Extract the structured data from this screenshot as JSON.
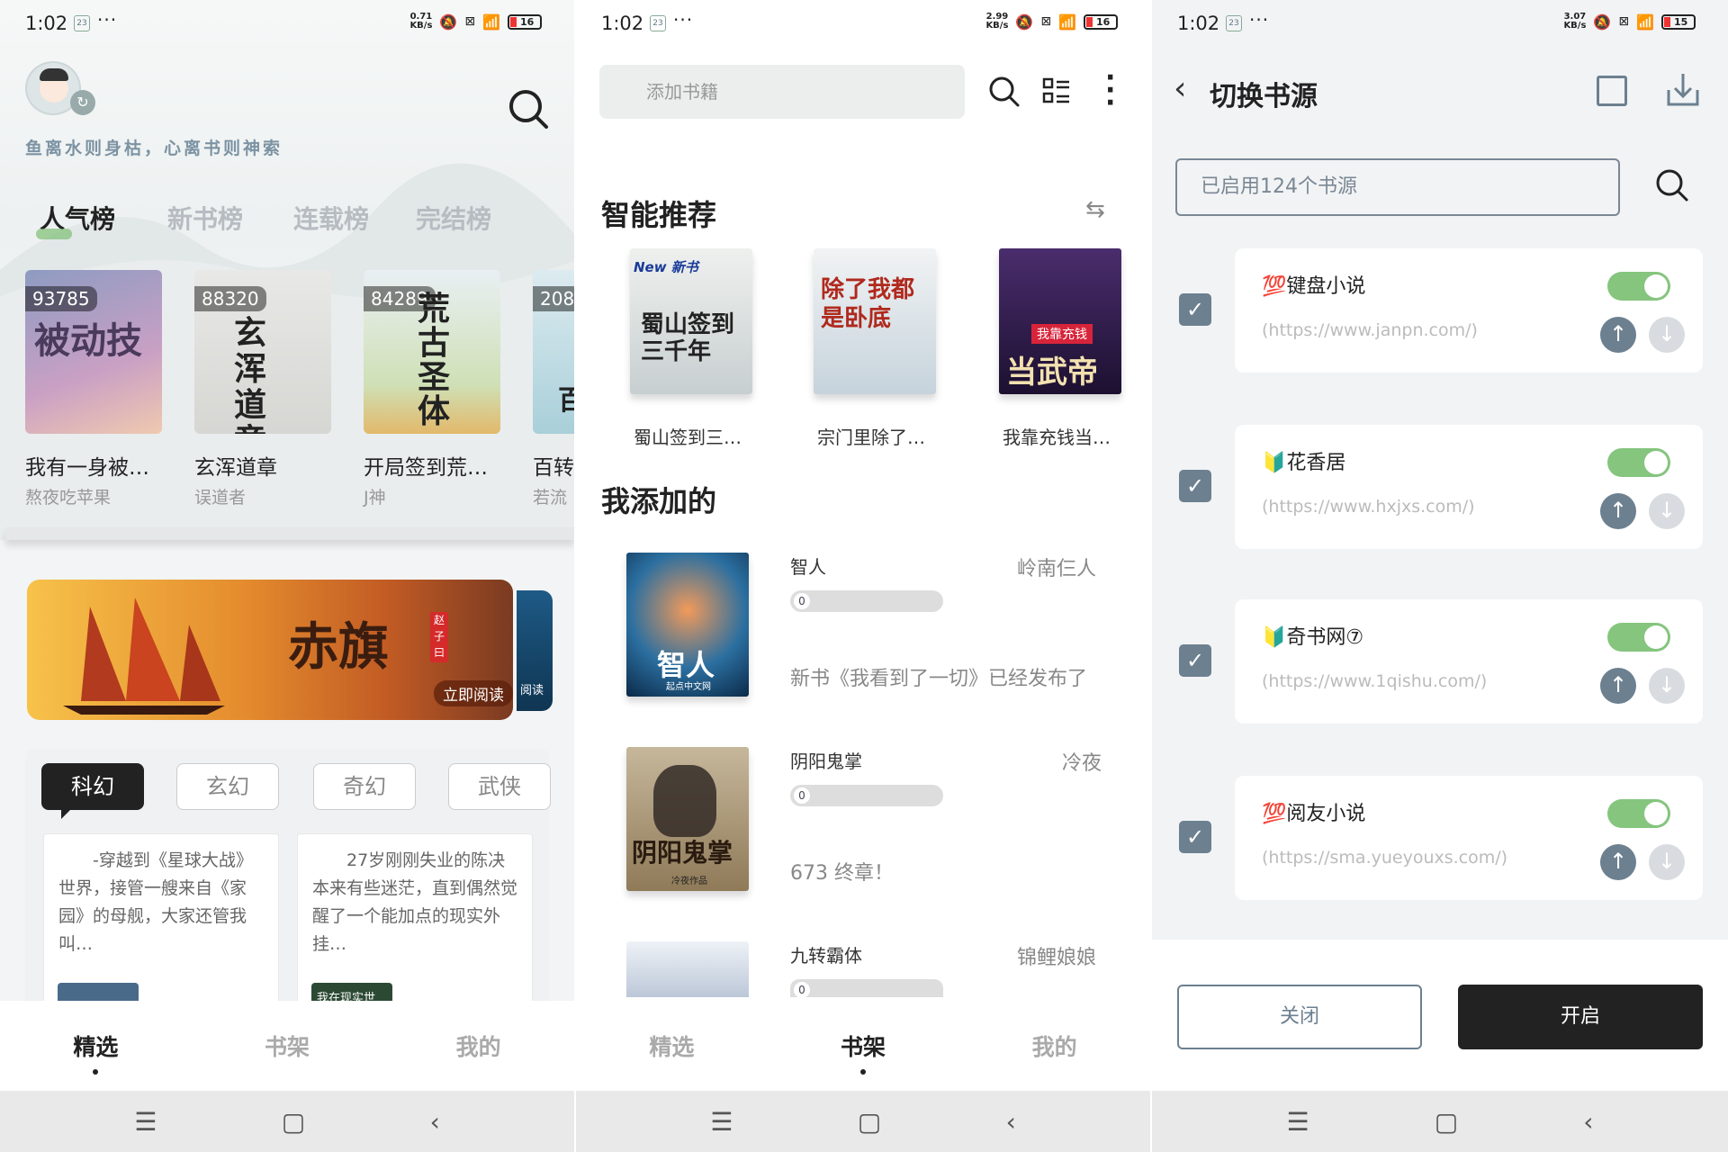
{
  "status_bars": [
    {
      "time": "1:02",
      "sim": "23",
      "speed": "0.71\nKB/s",
      "battery": "16"
    },
    {
      "time": "1:02",
      "sim": "23",
      "speed": "2.99\nKB/s",
      "battery": "16"
    },
    {
      "time": "1:02",
      "sim": "23",
      "speed": "3.07\nKB/s",
      "battery": "15"
    }
  ],
  "discover": {
    "slogan": "鱼离水则身枯，心离书则神索",
    "rank_tabs": [
      "人气榜",
      "新书榜",
      "连载榜",
      "完结榜"
    ],
    "ranked_books": [
      {
        "count": "93785",
        "cover_text": "被动技",
        "title": "我有一身被…",
        "author": "熬夜吃苹果"
      },
      {
        "count": "88320",
        "cover_text": "玄浑道章",
        "title": "玄浑道章",
        "author": "误道者"
      },
      {
        "count": "84289",
        "cover_text": "荒古圣体",
        "title": "开局签到荒…",
        "author": "J神"
      },
      {
        "count": "208",
        "cover_text": "百",
        "title": "百转",
        "author": "若流"
      }
    ],
    "banner": {
      "title": "赤旗",
      "seal": "赵子曰",
      "cta": "立即阅读",
      "cta2": "阅读"
    },
    "genres": [
      "科幻",
      "玄幻",
      "奇幻",
      "武侠"
    ],
    "summaries": [
      {
        "text": "　　-穿越到《星球大战》世界，接管一艘来自《家园》的母舰，大家还管我叫…"
      },
      {
        "text": "　　27岁刚刚失业的陈决本来有些迷茫，直到偶然觉醒了一个能加点的现实外挂…",
        "thumb": "我在现实世"
      }
    ]
  },
  "bookshelf": {
    "search_placeholder": "添加书籍",
    "rec_heading": "智能推荐",
    "recommended": [
      {
        "cover_text": "蜀山签到三千年",
        "tag": "New 新书",
        "title": "蜀山签到三…"
      },
      {
        "cover_text": "除了我都是卧底",
        "tag": "",
        "title": "宗门里除了…"
      },
      {
        "cover_text": "当武帝",
        "tag": "我靠充钱",
        "title": "我靠充钱当…"
      }
    ],
    "added_heading": "我添加的",
    "my_books": [
      {
        "title": "智人",
        "author": "岭南仨人",
        "progress": "0",
        "latest": "新书《我看到了一切》已经发布了",
        "cover_text": "智人",
        "cover_sub": "起点中文网"
      },
      {
        "title": "阴阳鬼掌",
        "author": "冷夜",
        "progress": "0",
        "latest": "673 终章！",
        "cover_text": "阴阳鬼掌",
        "cover_sub": "冷夜作品"
      },
      {
        "title": "九转霸体",
        "author": "锦鲤娘娘",
        "progress": "0",
        "latest": "",
        "cover_text": "",
        "cover_sub": ""
      }
    ]
  },
  "sources": {
    "title": "切换书源",
    "search_value": "已启用124个书源",
    "items": [
      {
        "badge": "💯",
        "name": "键盘小说",
        "url": "(https://www.janpn.com/)",
        "enabled": true
      },
      {
        "badge": "🔰",
        "name": "花香居",
        "url": "(https://www.hxjxs.com/)",
        "enabled": true
      },
      {
        "badge": "🔰",
        "name": "奇书网⑦",
        "url": "(https://www.1qishu.com/)",
        "enabled": true
      },
      {
        "badge": "💯",
        "name": "阅友小说",
        "url": "(https://sma.yueyouxs.com/)",
        "enabled": true
      }
    ],
    "close_label": "关闭",
    "open_label": "开启"
  },
  "tabs": [
    "精选",
    "书架",
    "我的"
  ],
  "colors": {
    "accent": "#6c8090",
    "toggle_on": "#85c57e",
    "dark": "#222222"
  }
}
